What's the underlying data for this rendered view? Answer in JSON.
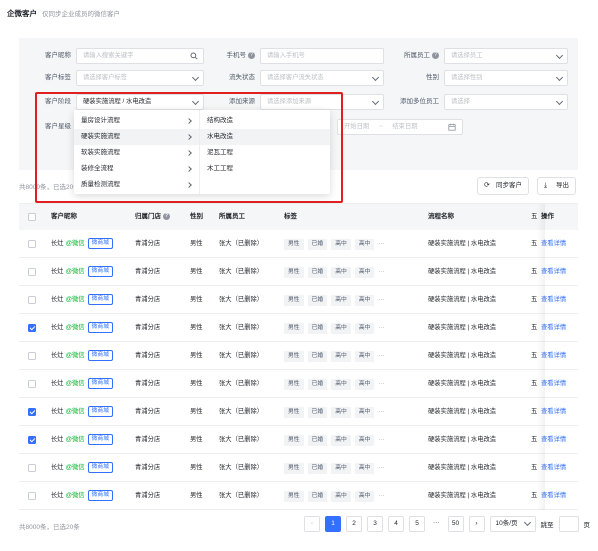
{
  "header": {
    "title": "企微客户",
    "subtitle": "仅同步企业成员的微信客户"
  },
  "filters": {
    "row1": [
      {
        "label": "客户昵称",
        "placeholder": "请输入搜索关键字",
        "icon": "search-icon"
      },
      {
        "label": "手机号",
        "placeholder": "请输入手机号",
        "help": "?"
      },
      {
        "label": "所属员工",
        "placeholder": "请选择员工",
        "help": "?"
      }
    ],
    "row2": [
      {
        "label": "客户标签",
        "placeholder": "请选择客户标签"
      },
      {
        "label": "流失状态",
        "placeholder": "请选择客户流失状态"
      },
      {
        "label": "性别",
        "placeholder": "请选择性别"
      }
    ],
    "row3": [
      {
        "label": "客户阶段",
        "value": "硬装实施流程 / 水电改造"
      },
      {
        "label": "添加来源",
        "placeholder": "请选择添加来源"
      },
      {
        "label": "添加多位员工",
        "placeholder": "请选择"
      }
    ],
    "row4": {
      "label": "客户星级",
      "start_placeholder": "开始日期",
      "sep": "~",
      "end_placeholder": "结束日期"
    }
  },
  "cascader": {
    "level1": [
      {
        "label": "量房设计流程",
        "active": false
      },
      {
        "label": "硬装实施流程",
        "active": true
      },
      {
        "label": "软装实施流程",
        "active": false
      },
      {
        "label": "装修全流程",
        "active": false
      },
      {
        "label": "质量检测流程",
        "active": false
      }
    ],
    "level2": [
      {
        "label": "结构改造",
        "active": false
      },
      {
        "label": "水电改造",
        "active": true
      },
      {
        "label": "泥瓦工程",
        "active": false
      },
      {
        "label": "木工工程",
        "active": false
      }
    ]
  },
  "toolbar": {
    "summary": "共8000条，已选20条",
    "sync_label": "同步客户",
    "export_label": "导出"
  },
  "table": {
    "headers": {
      "nickname": "客户昵称",
      "store": "归属门店",
      "gender": "性别",
      "employee": "所属员工",
      "tags": "标签",
      "flow": "流程名称",
      "stage": "五",
      "op": "操作"
    },
    "rows": [
      {
        "checked": false,
        "name": "长灶",
        "wx": "@微信",
        "badge": "微商城",
        "store": "青浦分店",
        "gender": "男性",
        "employee": "张大（已删除）",
        "tags": [
          "男性",
          "已婚",
          "高中",
          "高中"
        ],
        "flow": "硬装实施流程 | 水电改造",
        "stage": "五",
        "op": "查看详情"
      },
      {
        "checked": false,
        "name": "长灶",
        "wx": "@微信",
        "badge": "微商城",
        "store": "青浦分店",
        "gender": "男性",
        "employee": "张大（已删除）",
        "tags": [
          "男性",
          "已婚",
          "高中",
          "高中"
        ],
        "flow": "硬装实施流程 | 水电改造",
        "stage": "五",
        "op": "查看详情"
      },
      {
        "checked": false,
        "name": "长灶",
        "wx": "@微信",
        "badge": "微商城",
        "store": "青浦分店",
        "gender": "男性",
        "employee": "张大（已删除）",
        "tags": [
          "男性",
          "已婚",
          "高中",
          "高中"
        ],
        "flow": "硬装实施流程 | 水电改造",
        "stage": "五",
        "op": "查看详情"
      },
      {
        "checked": true,
        "name": "长灶",
        "wx": "@微信",
        "badge": "微商城",
        "store": "青浦分店",
        "gender": "男性",
        "employee": "张大（已删除）",
        "tags": [
          "男性",
          "已婚",
          "高中",
          "高中"
        ],
        "flow": "硬装实施流程 | 水电改造",
        "stage": "五",
        "op": "查看详情"
      },
      {
        "checked": false,
        "name": "长灶",
        "wx": "@微信",
        "badge": "微商城",
        "store": "青浦分店",
        "gender": "男性",
        "employee": "张大（已删除）",
        "tags": [
          "男性",
          "已婚",
          "高中",
          "高中"
        ],
        "flow": "硬装实施流程 | 水电改造",
        "stage": "五",
        "op": "查看详情"
      },
      {
        "checked": false,
        "name": "长灶",
        "wx": "@微信",
        "badge": "微商城",
        "store": "青浦分店",
        "gender": "男性",
        "employee": "张大（已删除）",
        "tags": [
          "男性",
          "已婚",
          "高中",
          "高中"
        ],
        "flow": "硬装实施流程 | 水电改造",
        "stage": "五",
        "op": "查看详情"
      },
      {
        "checked": true,
        "name": "长灶",
        "wx": "@微信",
        "badge": "微商城",
        "store": "青浦分店",
        "gender": "男性",
        "employee": "张大（已删除）",
        "tags": [
          "男性",
          "已婚",
          "高中",
          "高中"
        ],
        "flow": "硬装实施流程 | 水电改造",
        "stage": "五",
        "op": "查看详情"
      },
      {
        "checked": true,
        "name": "长灶",
        "wx": "@微信",
        "badge": "微商城",
        "store": "青浦分店",
        "gender": "男性",
        "employee": "张大（已删除）",
        "tags": [
          "男性",
          "已婚",
          "高中",
          "高中"
        ],
        "flow": "硬装实施流程 | 水电改造",
        "stage": "五",
        "op": "查看详情"
      },
      {
        "checked": false,
        "name": "长灶",
        "wx": "@微信",
        "badge": "微商城",
        "store": "青浦分店",
        "gender": "男性",
        "employee": "张大（已删除）",
        "tags": [
          "男性",
          "已婚",
          "高中",
          "高中"
        ],
        "flow": "硬装实施流程 | 水电改造",
        "stage": "五",
        "op": "查看详情"
      },
      {
        "checked": false,
        "name": "长灶",
        "wx": "@微信",
        "badge": "微商城",
        "store": "青浦分店",
        "gender": "男性",
        "employee": "张大（已删除）",
        "tags": [
          "男性",
          "已婚",
          "高中",
          "高中"
        ],
        "flow": "硬装实施流程 | 水电改造",
        "stage": "五",
        "op": "查看详情"
      }
    ]
  },
  "pagination": {
    "summary": "共8000条，已选20条",
    "pages": [
      "1",
      "2",
      "3",
      "4",
      "5"
    ],
    "ellipsis": "···",
    "last": "50",
    "current": "1",
    "page_size": "10条/页",
    "jump_label": "跳至",
    "jump_suffix": "页"
  },
  "colors": {
    "accent": "#3370ff",
    "highlight": "#e02020",
    "wechat": "#00b42a"
  }
}
